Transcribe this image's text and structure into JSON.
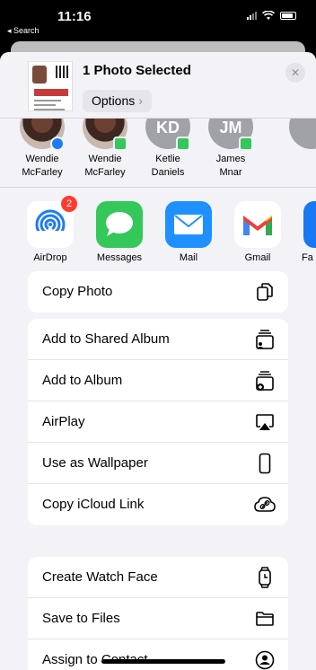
{
  "status_bar": {
    "time": "11:16",
    "back_label": "◂ Search"
  },
  "share_header": {
    "title": "1 Photo Selected",
    "options_label": "Options",
    "close_icon": "close-icon"
  },
  "contacts": [
    {
      "first": "Wendie",
      "last": "McFarley",
      "badge": "airdrop"
    },
    {
      "first": "Wendie",
      "last": "McFarley",
      "badge": "messages"
    },
    {
      "first": "Ketlie",
      "last": "Daniels",
      "initials": "KD",
      "badge": "messages"
    },
    {
      "first": "James",
      "last": "Mnar",
      "initials": "JM",
      "badge": "messages"
    }
  ],
  "apps": [
    {
      "label": "AirDrop",
      "icon": "airdrop-icon",
      "badge": "2",
      "color": "#ffffff"
    },
    {
      "label": "Messages",
      "icon": "messages-icon",
      "color": "#34c759"
    },
    {
      "label": "Mail",
      "icon": "mail-icon",
      "color": "#1e90ff"
    },
    {
      "label": "Gmail",
      "icon": "gmail-icon",
      "color": "#ffffff"
    },
    {
      "label": "Fa",
      "icon": "facebook-icon",
      "color": "#1877f2"
    }
  ],
  "actions_group1": [
    {
      "label": "Copy Photo",
      "icon": "copy-photo-icon"
    }
  ],
  "actions_group2": [
    {
      "label": "Add to Shared Album",
      "icon": "shared-album-icon"
    },
    {
      "label": "Add to Album",
      "icon": "add-album-icon"
    },
    {
      "label": "AirPlay",
      "icon": "airplay-icon"
    },
    {
      "label": "Use as Wallpaper",
      "icon": "phone-icon"
    },
    {
      "label": "Copy iCloud Link",
      "icon": "icloud-link-icon"
    }
  ],
  "actions_group3": [
    {
      "label": "Create Watch Face",
      "icon": "watch-icon"
    },
    {
      "label": "Save to Files",
      "icon": "folder-icon"
    },
    {
      "label": "Assign to Contact",
      "icon": "contact-icon"
    }
  ]
}
